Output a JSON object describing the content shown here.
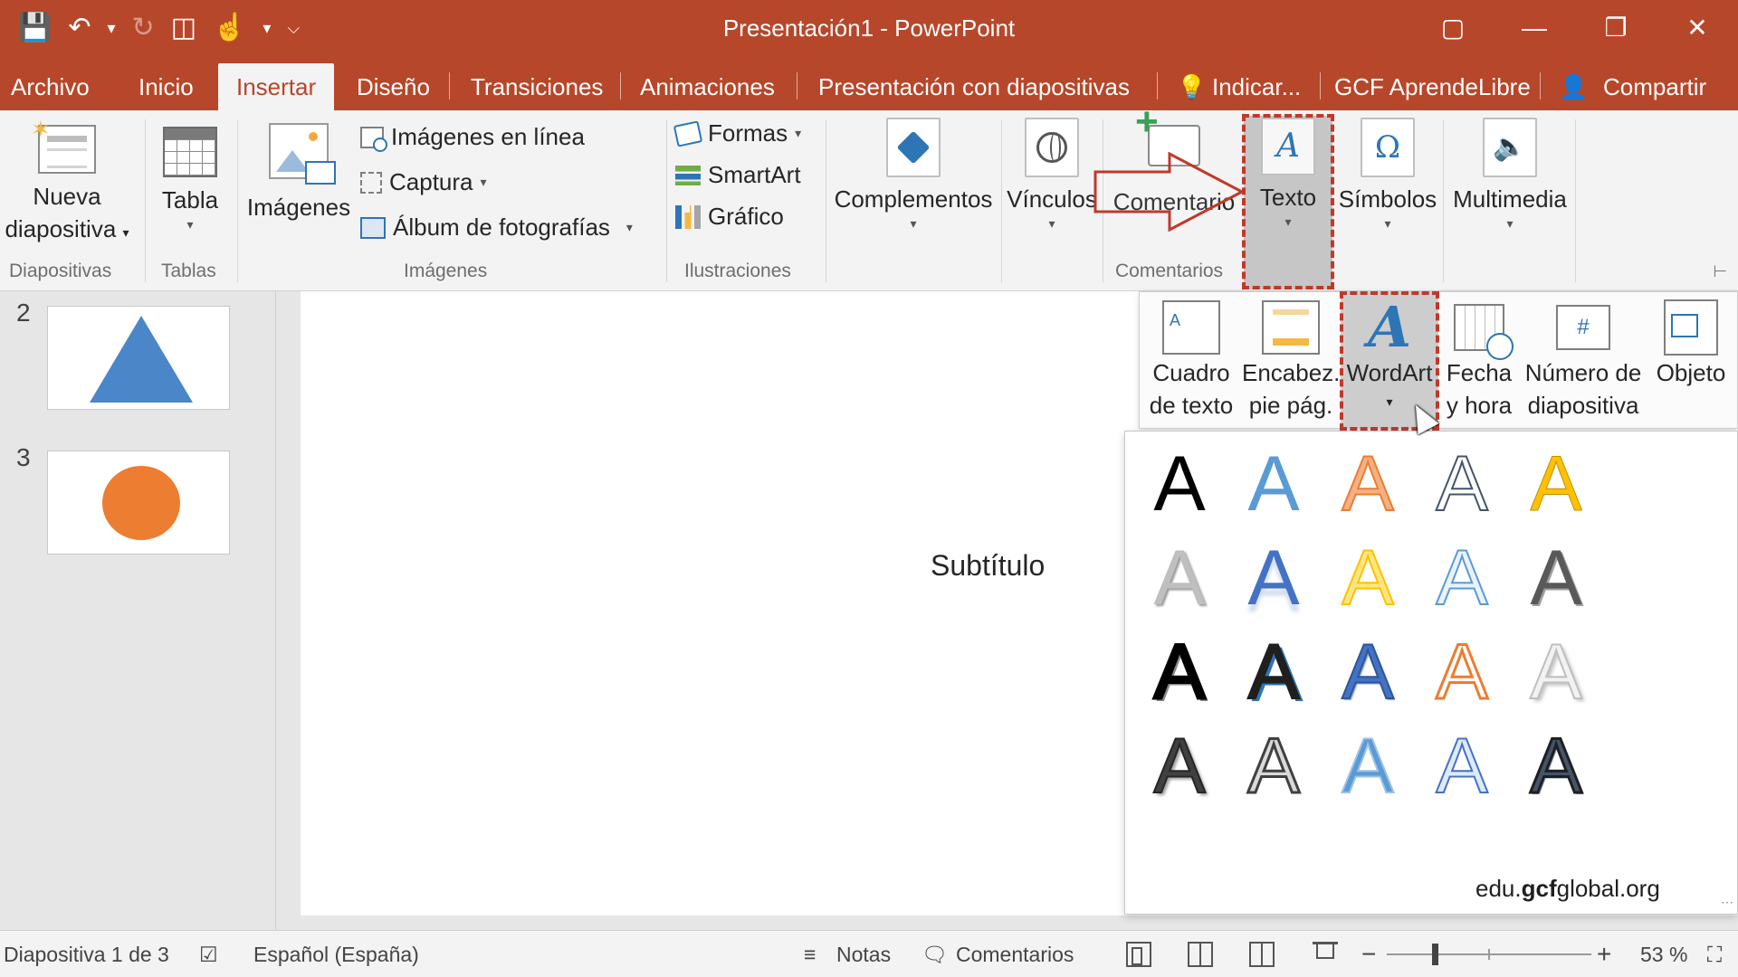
{
  "window": {
    "title": "Presentación1 - PowerPoint",
    "qat_icons": [
      "save-icon",
      "undo-icon",
      "redo-icon",
      "present-from-start-icon",
      "touch-mode-icon",
      "customize-qat-icon"
    ],
    "controls": [
      "ribbon-display-options-icon",
      "minimize-icon",
      "restore-icon",
      "close-icon"
    ]
  },
  "tabs": {
    "items": [
      "Archivo",
      "Inicio",
      "Insertar",
      "Diseño",
      "Transiciones",
      "Animaciones",
      "Presentación con diapositivas",
      "Indicar...",
      "GCF AprendeLibre"
    ],
    "active": "Insertar",
    "share": "Compartir"
  },
  "ribbon": {
    "nueva_line1": "Nueva",
    "nueva_line2": "diapositiva",
    "tabla": "Tabla",
    "imagenes": "Imágenes",
    "imagenes_linea": "Imágenes en línea",
    "captura": "Captura",
    "album": "Álbum de fotografías",
    "formas": "Formas",
    "smartart": "SmartArt",
    "grafico": "Gráfico",
    "complementos": "Complementos",
    "vinculos": "Vínculos",
    "comentario": "Comentario",
    "texto": "Texto",
    "simbolos": "Símbolos",
    "multimedia": "Multimedia",
    "groups": {
      "diapositivas": "Diapositivas",
      "tablas": "Tablas",
      "imagenes": "Imágenes",
      "ilustraciones": "Ilustraciones",
      "comentarios": "Comentarios"
    }
  },
  "texto_menu": {
    "cuadro_1": "Cuadro",
    "cuadro_2": "de texto",
    "encab_1": "Encabez.",
    "encab_2": "pie pág.",
    "wordart": "WordArt",
    "fecha_1": "Fecha",
    "fecha_2": "y hora",
    "numero_1": "Número de",
    "numero_2": "diapositiva",
    "objeto": "Objeto"
  },
  "wordart_gallery": {
    "glyph": "A",
    "styles": [
      "wa-s1",
      "wa-s2",
      "wa-s3",
      "wa-s4",
      "wa-s5",
      "wa-s6",
      "wa-s7",
      "wa-s8",
      "wa-s9",
      "wa-s10",
      "wa-s11",
      "wa-s12",
      "wa-s13",
      "wa-s14",
      "wa-s15",
      "wa-s16",
      "wa-s17",
      "wa-s18",
      "wa-s19",
      "wa-s20"
    ],
    "columns": 5
  },
  "watermark": {
    "pre": "edu.",
    "bold": "gcf",
    "post": "global.org"
  },
  "slides": {
    "thumbnails": [
      {
        "number": "2",
        "shape": "triangle",
        "color": "#4a86c8"
      },
      {
        "number": "3",
        "shape": "circle",
        "color": "#ed7d31"
      }
    ],
    "subtitle": "Subtítulo"
  },
  "status": {
    "slide_info": "Diapositiva 1 de 3",
    "language": "Español (España)",
    "notes": "Notas",
    "comments": "Comentarios",
    "zoom": "53 %",
    "zoom_minus": "−",
    "zoom_plus": "+"
  },
  "colors": {
    "brand": "#b7472a",
    "highlight_dash": "#c0392b",
    "accent_blue": "#2e75b6"
  }
}
